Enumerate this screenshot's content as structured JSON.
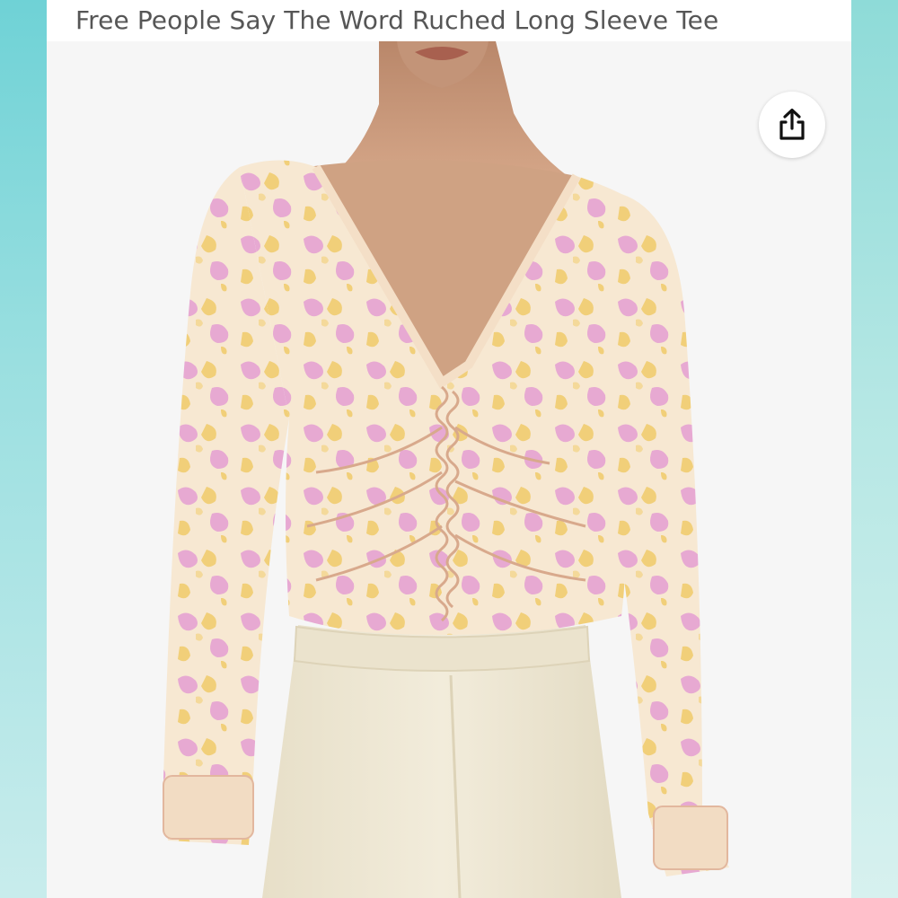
{
  "product": {
    "title": "Free People Say The Word Ruched Long Sleeve Tee"
  },
  "actions": {
    "share_icon": "share-icon"
  },
  "colors": {
    "accent_edge": "#7fd6da",
    "title_text": "#565656",
    "garment_base": "#f7e8d2",
    "print_pink": "#e7a9d2",
    "print_yellow": "#f1cf79",
    "pants": "#eee7d3",
    "skin": "#c99878"
  }
}
